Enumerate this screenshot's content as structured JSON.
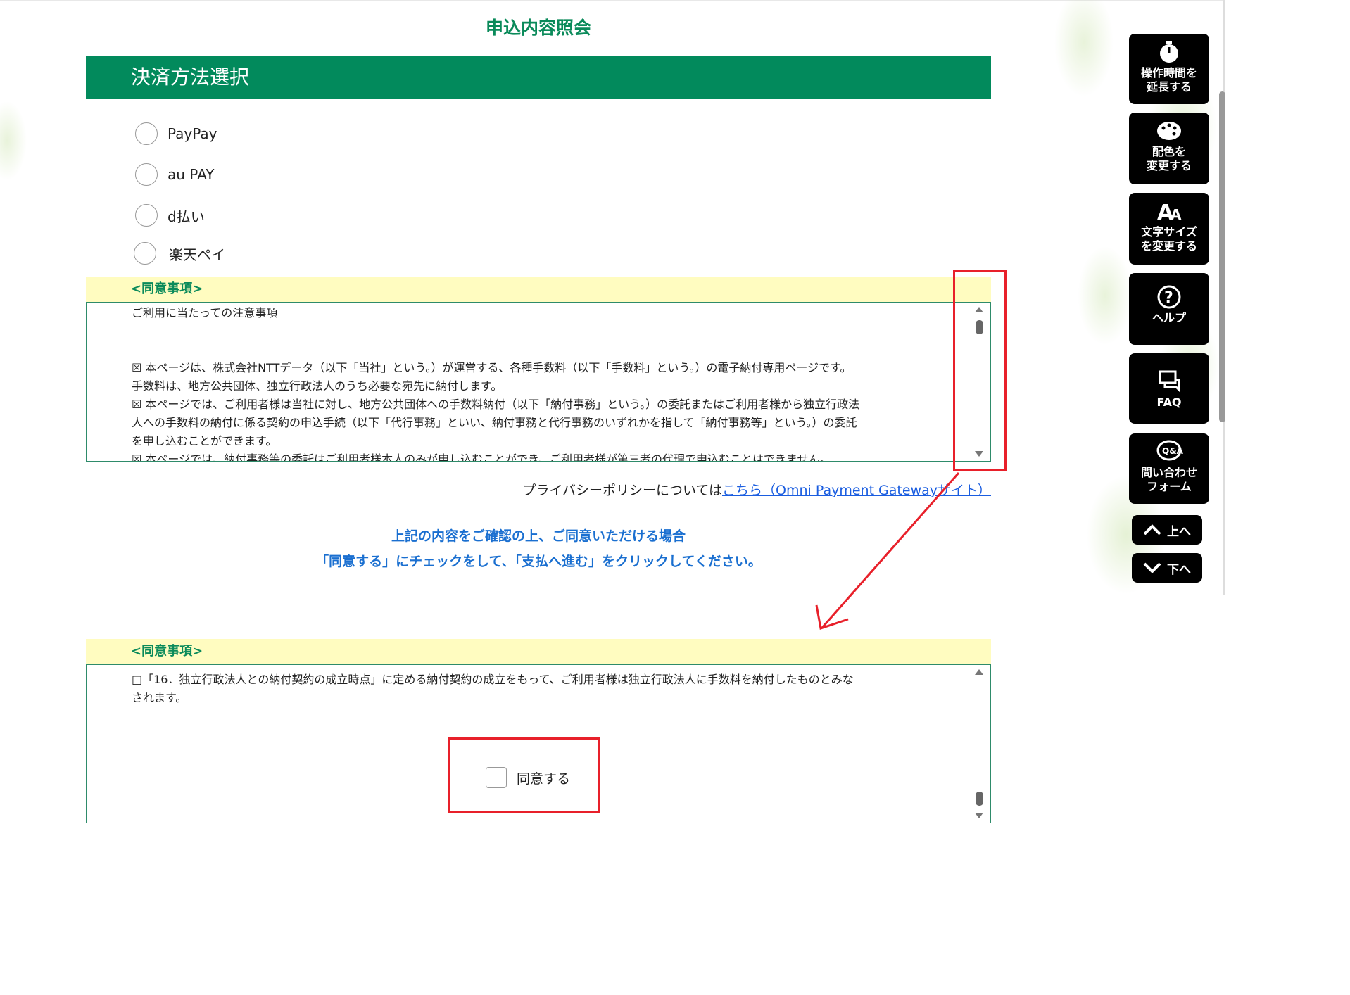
{
  "page_title": "申込内容照会",
  "section_title": "決済方法選択",
  "payment_options": [
    {
      "label": "PayPay"
    },
    {
      "label": "au PAY"
    },
    {
      "label": "d払い"
    },
    {
      "label": "楽天ペイ"
    }
  ],
  "agreement_banner": "<同意事項>",
  "terms_top": {
    "heading": "ご利用に当たっての注意事項",
    "lines": [
      "☒ 本ページは、株式会社NTTデータ（以下「当社」という。）が運営する、各種手数料（以下「手数料」という。）の電子納付専用ページです。",
      "手数料は、地方公共団体、独立行政法人のうち必要な宛先に納付します。",
      "☒ 本ページでは、ご利用者様は当社に対し、地方公共団体への手数料納付（以下「納付事務」という。）の委託またはご利用者様から独立行政法",
      "人への手数料の納付に係る契約の申込手続（以下「代行事務」といい、納付事務と代行事務のいずれかを指して「納付事務等」という。）の委託",
      "を申し込むことができます。",
      "☒ 本ページでは、納付事務等の委託はご利用者様本人のみが申し込むことができ、ご利用者様が第三者の代理で申込むことはできません。"
    ]
  },
  "privacy": {
    "prefix": "プライバシーポリシーについては",
    "link": "こちら（Omni Payment Gatewayサイト）"
  },
  "notice": {
    "line1": "上記の内容をご確認の上、ご同意いただける場合",
    "line2": "「同意する」にチェックをして、「支払へ進む」をクリックしてください。"
  },
  "terms_bottom": {
    "lines": [
      "□「16．独立行政法人との納付契約の成立時点」に定める納付契約の成立をもって、ご利用者様は独立行政法人に手数料を納付したものとみな",
      "されます。"
    ],
    "agree_label": "同意する"
  },
  "toolbar": {
    "extend_time": [
      "操作時間を",
      "延長する"
    ],
    "change_color": [
      "配色を",
      "変更する"
    ],
    "font_size": [
      "文字サイズ",
      "を変更する"
    ],
    "help": "ヘルプ",
    "faq": "FAQ",
    "contact": [
      "問い合わせ",
      "フォーム"
    ],
    "up": "上へ",
    "down": "下へ"
  },
  "colors": {
    "brand_green": "#028a5c",
    "banner_yellow": "#fffcc0",
    "notice_blue": "#1a6fd0",
    "annotation_red": "#e8202a"
  }
}
